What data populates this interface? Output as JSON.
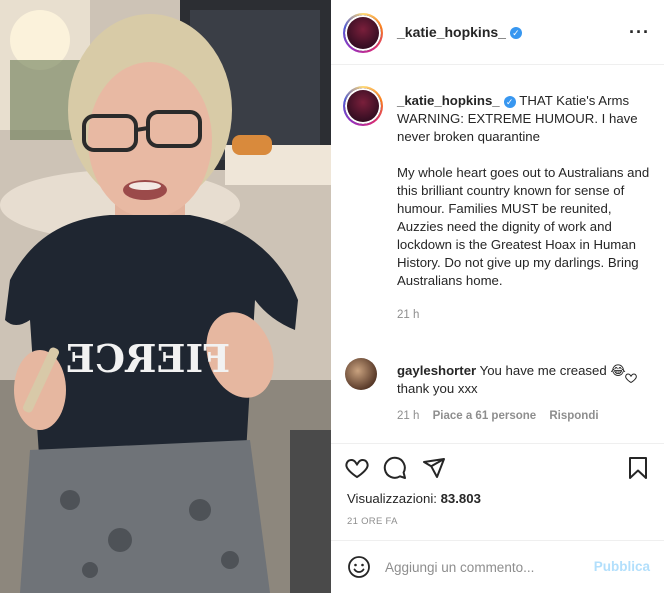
{
  "header": {
    "username": "_katie_hopkins_",
    "verified_icon": "verified-badge-icon",
    "more_icon": "more-options-icon"
  },
  "caption": {
    "username": "_katie_hopkins_",
    "line1": "THAT Katie's Arms WARNING: EXTREME HUMOUR. I have never broken quarantine",
    "line2": "My whole heart goes out to Australians and this brilliant country known for sense of humour. Families MUST be reunited, Auzzies need the dignity of work and lockdown is the Greatest Hoax in Human History. Do not give up my darlings. Bring Australians home.",
    "time": "21 h"
  },
  "comment": {
    "username": "gayleshorter",
    "text": "You have me creased 😂 thank you xxx",
    "time": "21 h",
    "likes": "Piace a 61 persone",
    "reply": "Rispondi"
  },
  "actions": {
    "views_label": "Visualizzazioni:",
    "views_count": "83.803",
    "ago": "21 ORE FA"
  },
  "add_comment": {
    "placeholder": "Aggiungi un commento...",
    "post_label": "Pubblica"
  },
  "media": {
    "shirt_text": "FIERCE"
  },
  "colors": {
    "accent": "#3897f0",
    "post_disabled": "#b2dffc",
    "muted": "#8e8e8e"
  }
}
